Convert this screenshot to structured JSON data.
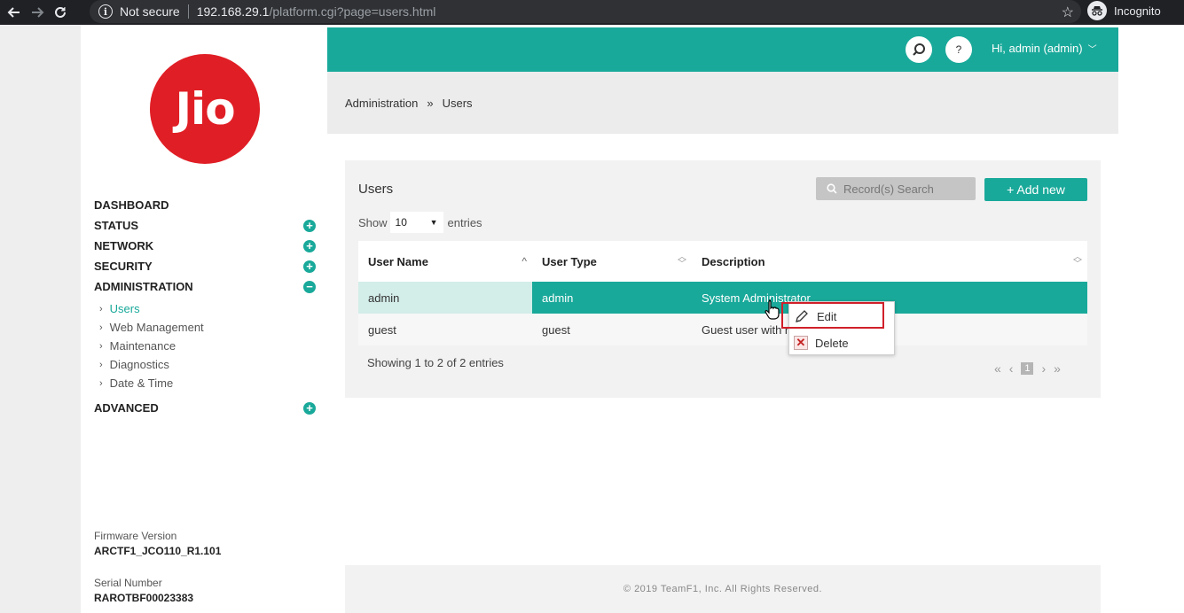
{
  "browser": {
    "security_label": "Not secure",
    "url_host": "192.168.29.1",
    "url_path": "/platform.cgi?page=users.html",
    "incognito_label": "Incognito"
  },
  "brand": {
    "logo_text": "Jio",
    "logo_color": "#e01e25",
    "accent_color": "#19a99a"
  },
  "sidebar": {
    "menu": [
      {
        "label": "DASHBOARD",
        "toggle": ""
      },
      {
        "label": "STATUS",
        "toggle": "+"
      },
      {
        "label": "NETWORK",
        "toggle": "+"
      },
      {
        "label": "SECURITY",
        "toggle": "+"
      },
      {
        "label": "ADMINISTRATION",
        "toggle": "−"
      }
    ],
    "submenu": [
      {
        "label": "Users",
        "active": true
      },
      {
        "label": "Web Management"
      },
      {
        "label": "Maintenance"
      },
      {
        "label": "Diagnostics"
      },
      {
        "label": "Date & Time"
      }
    ],
    "advanced": {
      "label": "ADVANCED",
      "toggle": "+"
    },
    "firmware_label": "Firmware Version",
    "firmware_value": "ARCTF1_JCO110_R1.101",
    "serial_label": "Serial Number",
    "serial_value": "RAROTBF00023383"
  },
  "header": {
    "help_label": "?",
    "user_label": "Hi, admin (admin)"
  },
  "breadcrumb": {
    "parent": "Administration",
    "separator": "»",
    "current": "Users"
  },
  "panel": {
    "title": "Users",
    "search_placeholder": "Record(s) Search",
    "add_label": "+ Add new",
    "show_label": "Show",
    "show_value": "10",
    "entries_label": "entries",
    "columns": [
      "User Name",
      "User Type",
      "Description"
    ],
    "rows": [
      {
        "name": "admin",
        "type": "admin",
        "description": "System Administrator"
      },
      {
        "name": "guest",
        "type": "guest",
        "description": "Guest user with r"
      }
    ],
    "showing_text": "Showing 1 to 2 of 2 entries",
    "current_page": "1"
  },
  "context_menu": {
    "edit_label": "Edit",
    "delete_label": "Delete"
  },
  "footer": {
    "copyright": "© 2019 TeamF1, Inc. All Rights Reserved."
  }
}
